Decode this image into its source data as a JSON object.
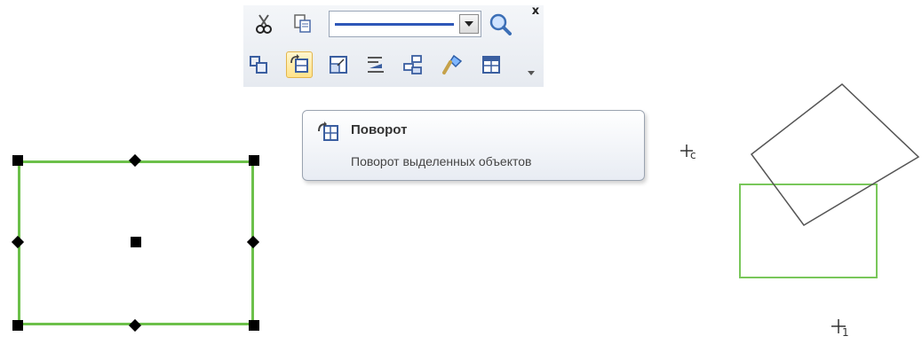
{
  "toolbar": {
    "close_label": "x",
    "line_style": {
      "selected": "solid line"
    },
    "buttons_row1": [
      {
        "name": "cut-icon"
      },
      {
        "name": "copy-icon"
      },
      {
        "name": "zoom-icon"
      }
    ],
    "buttons_row2": [
      {
        "name": "group-icon"
      },
      {
        "name": "rotate-icon",
        "active": true
      },
      {
        "name": "resize-icon"
      },
      {
        "name": "align-icon"
      },
      {
        "name": "arrange-icon"
      },
      {
        "name": "format-painter-icon"
      },
      {
        "name": "table-icon"
      },
      {
        "name": "more-icon"
      }
    ]
  },
  "tooltip": {
    "title": "Поворот",
    "description": "Поворот выделенных объектов"
  },
  "canvas": {
    "cursor_label_1": "c",
    "cursor_label_2": "1"
  },
  "colors": {
    "selection_border": "#6cc04a",
    "handle": "#000000",
    "line_sample": "#2e57b8",
    "active_button_bg": "#ffe38a"
  }
}
